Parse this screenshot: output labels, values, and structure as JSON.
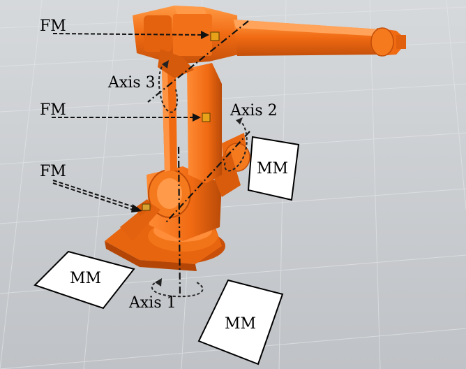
{
  "annotations": {
    "fm_top": "FM",
    "fm_mid": "FM",
    "fm_bottom": "FM",
    "axis_1": "Axis 1",
    "axis_2": "Axis 2",
    "axis_3": "Axis 3",
    "mm_left": "MM",
    "mm_right": "MM",
    "mm_bottom": "MM"
  },
  "colors": {
    "robot_orange": "#f06a12",
    "robot_shadow": "#c9500a",
    "robot_light": "#ff8a33",
    "floor": "#c9ccd0",
    "grid": "#dde0e3",
    "sensor": "#e8a21a"
  }
}
